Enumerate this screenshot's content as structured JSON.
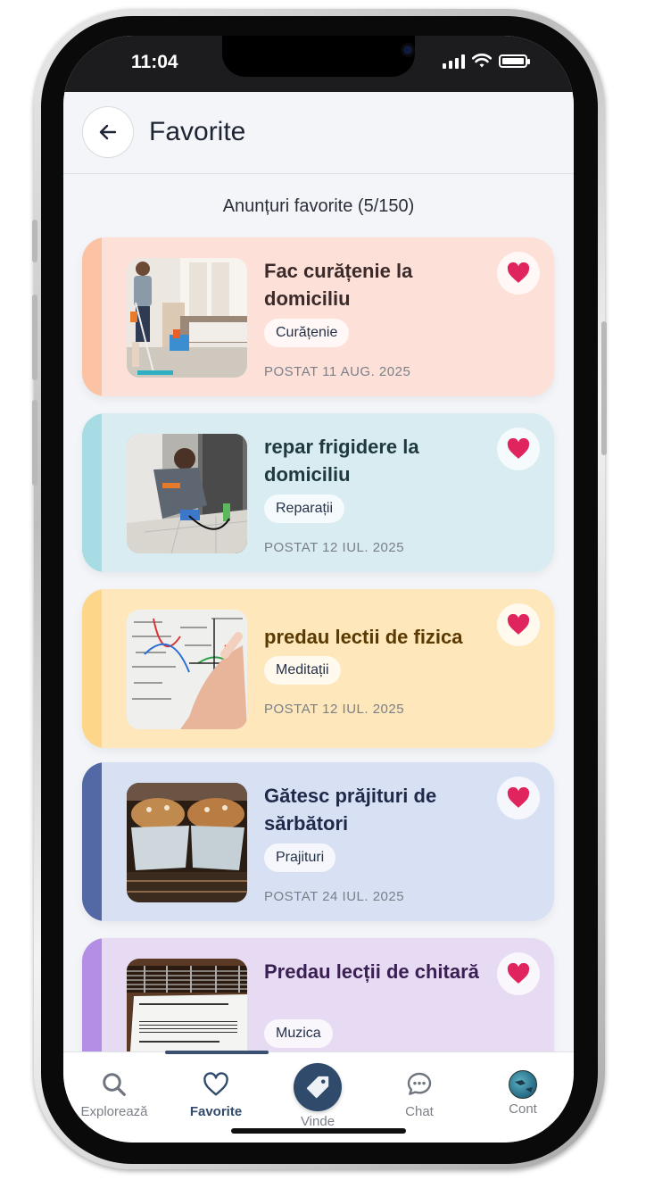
{
  "status_bar": {
    "time": "11:04"
  },
  "header": {
    "back_icon": "arrow-left-icon",
    "title": "Favorite"
  },
  "subtitle": "Anunțuri favorite (5/150)",
  "colors": {
    "accent": "#2f4a6b",
    "heart": "#e0245e"
  },
  "listings": [
    {
      "title": "Fac curățenie la domiciliu",
      "tag": "Curățenie",
      "date": "POSTAT 11 AUG. 2025",
      "bg": "#fde1d9",
      "stripe": "#fcc2a4",
      "title_color": "#3a2a2a"
    },
    {
      "title": "repar frigidere la domiciliu",
      "tag": "Reparații",
      "date": "POSTAT 12 IUL. 2025",
      "bg": "#d8ecf1",
      "stripe": "#a7dce4",
      "title_color": "#1f3a3f"
    },
    {
      "title": "predau lectii de fizica",
      "tag": "Meditații",
      "date": "POSTAT 12 IUL. 2025",
      "bg": "#fde7bb",
      "stripe": "#fdd68a",
      "title_color": "#5a3a00"
    },
    {
      "title": "Gătesc prăjituri de sărbători",
      "tag": "Prajituri",
      "date": "POSTAT 24 IUL. 2025",
      "bg": "#d8e0f3",
      "stripe": "#5369a6",
      "title_color": "#1f2a4a"
    },
    {
      "title": "Predau lecții de chitară",
      "tag": "Muzica",
      "date": "",
      "bg": "#e6dbf3",
      "stripe": "#b48ee4",
      "title_color": "#3a1f52"
    }
  ],
  "bottom_nav": [
    {
      "label": "Explorează",
      "icon": "search-icon"
    },
    {
      "label": "Favorite",
      "icon": "heart-outline-icon"
    },
    {
      "label": "Vinde",
      "icon": "tag-icon"
    },
    {
      "label": "Chat",
      "icon": "chat-bubble-icon"
    },
    {
      "label": "Cont",
      "icon": "avatar-icon"
    }
  ]
}
